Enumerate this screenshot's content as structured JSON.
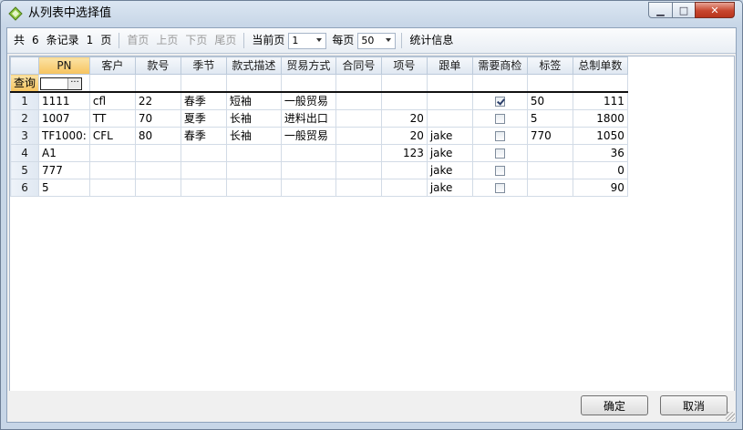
{
  "window": {
    "title": "从列表中选择值",
    "icon": "diamond-icon",
    "controls": {
      "minimize": "▁",
      "maximize": "□",
      "close": "✕"
    }
  },
  "toolbar": {
    "total_prefix": "共",
    "total_count": "6",
    "record_label": "条记录",
    "page_count": "1",
    "page_label": "页",
    "first": "首页",
    "prev": "上页",
    "next": "下页",
    "last": "尾页",
    "current_page_label": "当前页",
    "current_page_value": "1",
    "per_page_label": "每页",
    "per_page_value": "50",
    "stats": "统计信息"
  },
  "grid": {
    "columns": [
      "PN",
      "客户",
      "款号",
      "季节",
      "款式描述",
      "贸易方式",
      "合同号",
      "项号",
      "跟单",
      "需要商检",
      "标签",
      "总制单数"
    ],
    "query_label": "查询",
    "query_button": "···",
    "rows": [
      {
        "n": "1",
        "pn": "1111",
        "customer": "cfl",
        "style": "22",
        "season": "春季",
        "desc": "短袖",
        "trade": "一般贸易",
        "contract": "",
        "item": "",
        "follow": "",
        "inspect": true,
        "label": "50",
        "total": "111"
      },
      {
        "n": "2",
        "pn": "1007",
        "customer": "TT",
        "style": "70",
        "season": "夏季",
        "desc": "长袖",
        "trade": "进料出口",
        "contract": "",
        "item": "20",
        "follow": "",
        "inspect": false,
        "label": "5",
        "total": "1800"
      },
      {
        "n": "3",
        "pn": "TF1000:",
        "customer": "CFL",
        "style": "80",
        "season": "春季",
        "desc": "长袖",
        "trade": "一般贸易",
        "contract": "",
        "item": "20",
        "follow": "jake",
        "inspect": false,
        "label": "770",
        "total": "1050"
      },
      {
        "n": "4",
        "pn": "A1",
        "customer": "",
        "style": "",
        "season": "",
        "desc": "",
        "trade": "",
        "contract": "",
        "item": "123",
        "follow": "jake",
        "inspect": false,
        "label": "",
        "total": "36"
      },
      {
        "n": "5",
        "pn": "777",
        "customer": "",
        "style": "",
        "season": "",
        "desc": "",
        "trade": "",
        "contract": "",
        "item": "",
        "follow": "jake",
        "inspect": false,
        "label": "",
        "total": "0"
      },
      {
        "n": "6",
        "pn": "5",
        "customer": "",
        "style": "",
        "season": "",
        "desc": "",
        "trade": "",
        "contract": "",
        "item": "",
        "follow": "jake",
        "inspect": false,
        "label": "",
        "total": "90"
      }
    ]
  },
  "footer": {
    "ok": "确定",
    "cancel": "取消"
  }
}
